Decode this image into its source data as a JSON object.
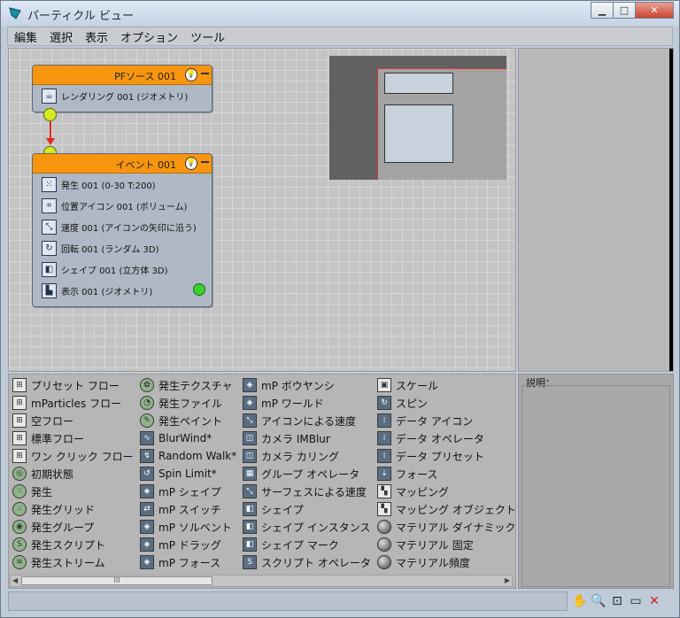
{
  "window": {
    "title": "パーティクル ビュー",
    "controls": {
      "minimize": "▁",
      "maximize": "□",
      "close": "✕"
    }
  },
  "menubar": {
    "items": [
      "編集",
      "選択",
      "表示",
      "オプション",
      "ツール"
    ]
  },
  "graph": {
    "pf_source": {
      "title": "PFソース 001",
      "operators": [
        {
          "label": "レンダリング 001 (ジオメトリ)",
          "icon": "render-teapot-icon",
          "glyph": "☕"
        }
      ]
    },
    "event": {
      "title": "イベント 001",
      "operators": [
        {
          "label": "発生 001 (0-30 T:200)",
          "icon": "birth-icon",
          "glyph": "⁙"
        },
        {
          "label": "位置アイコン 001 (ボリューム)",
          "icon": "position-icon",
          "glyph": "⌗"
        },
        {
          "label": "速度 001 (アイコンの矢印に沿う)",
          "icon": "speed-icon",
          "glyph": "⤡"
        },
        {
          "label": "回転 001 (ランダム 3D)",
          "icon": "rotation-icon",
          "glyph": "↻"
        },
        {
          "label": "シェイプ 001 (立方体 3D)",
          "icon": "shape-icon",
          "glyph": "◧"
        },
        {
          "label": "表示 001 (ジオメトリ)",
          "icon": "display-icon",
          "glyph": "▙"
        }
      ],
      "status_color": "#37d12d"
    },
    "wire_color": "#e0271c",
    "header_color": "#f7950f"
  },
  "depot": {
    "columns": [
      [
        {
          "label": "プリセット フロー",
          "icon": "flow-icon",
          "glyph": "⊞",
          "style": ""
        },
        {
          "label": "mParticles フロー",
          "icon": "flow-icon",
          "glyph": "⊞",
          "style": ""
        },
        {
          "label": "空フロー",
          "icon": "flow-icon",
          "glyph": "⊞",
          "style": ""
        },
        {
          "label": "標準フロー",
          "icon": "flow-icon",
          "glyph": "⊞",
          "style": ""
        },
        {
          "label": "ワン クリック フロー",
          "icon": "flow-icon",
          "glyph": "⊞",
          "style": ""
        },
        {
          "label": "初期状態",
          "icon": "initial-state-icon",
          "glyph": "◎",
          "style": "green"
        },
        {
          "label": "発生",
          "icon": "birth-icon",
          "glyph": "⁙",
          "style": "green"
        },
        {
          "label": "発生グリッド",
          "icon": "birth-grid-icon",
          "glyph": "⁙",
          "style": "green"
        },
        {
          "label": "発生グループ",
          "icon": "birth-group-icon",
          "glyph": "◉",
          "style": "green"
        },
        {
          "label": "発生スクリプト",
          "icon": "birth-script-icon",
          "glyph": "S",
          "style": "green"
        },
        {
          "label": "発生ストリーム",
          "icon": "birth-stream-icon",
          "glyph": "≋",
          "style": "green"
        }
      ],
      [
        {
          "label": "発生テクスチャ",
          "icon": "birth-texture-icon",
          "glyph": "✿",
          "style": "green"
        },
        {
          "label": "発生ファイル",
          "icon": "birth-file-icon",
          "glyph": "◔",
          "style": "green"
        },
        {
          "label": "発生ペイント",
          "icon": "birth-paint-icon",
          "glyph": "✎",
          "style": "green"
        },
        {
          "label": "BlurWind*",
          "icon": "blurwind-icon",
          "glyph": "∿",
          "style": "dark"
        },
        {
          "label": "Random Walk*",
          "icon": "random-walk-icon",
          "glyph": "↯",
          "style": "dark"
        },
        {
          "label": "Spin Limit*",
          "icon": "spin-limit-icon",
          "glyph": "↺",
          "style": "dark"
        },
        {
          "label": "mP シェイプ",
          "icon": "mp-shape-icon",
          "glyph": "◈",
          "style": "dark"
        },
        {
          "label": "mP スイッチ",
          "icon": "mp-switch-icon",
          "glyph": "⇄",
          "style": "dark"
        },
        {
          "label": "mP ソルベント",
          "icon": "mp-solvent-icon",
          "glyph": "◈",
          "style": "dark"
        },
        {
          "label": "mP ドラッグ",
          "icon": "mp-drag-icon",
          "glyph": "◈",
          "style": "dark"
        },
        {
          "label": "mP フォース",
          "icon": "mp-force-icon",
          "glyph": "◈",
          "style": "dark"
        }
      ],
      [
        {
          "label": "mP ボウヤンシ",
          "icon": "mp-buoyancy-icon",
          "glyph": "◈",
          "style": "dark"
        },
        {
          "label": "mP ワールド",
          "icon": "mp-world-icon",
          "glyph": "◈",
          "style": "dark"
        },
        {
          "label": "アイコンによる速度",
          "icon": "speed-by-icon-icon",
          "glyph": "⤡",
          "style": "dark"
        },
        {
          "label": "カメラ IMBlur",
          "icon": "camera-imblur-icon",
          "glyph": "◫",
          "style": "dark"
        },
        {
          "label": "カメラ カリング",
          "icon": "camera-culling-icon",
          "glyph": "◫",
          "style": "dark"
        },
        {
          "label": "グループ オペレータ",
          "icon": "group-operator-icon",
          "glyph": "▦",
          "style": "dark"
        },
        {
          "label": "サーフェスによる速度",
          "icon": "speed-by-surface-icon",
          "glyph": "⤡",
          "style": "dark"
        },
        {
          "label": "シェイプ",
          "icon": "shape-icon",
          "glyph": "◧",
          "style": "dark"
        },
        {
          "label": "シェイプ インスタンス",
          "icon": "shape-instance-icon",
          "glyph": "◧",
          "style": "dark"
        },
        {
          "label": "シェイプ マーク",
          "icon": "shape-mark-icon",
          "glyph": "◧",
          "style": "dark"
        },
        {
          "label": "スクリプト オペレータ",
          "icon": "script-operator-icon",
          "glyph": "S",
          "style": "dark"
        }
      ],
      [
        {
          "label": "スケール",
          "icon": "scale-icon",
          "glyph": "▣",
          "style": ""
        },
        {
          "label": "スピン",
          "icon": "spin-icon",
          "glyph": "↻",
          "style": "dark"
        },
        {
          "label": "データ アイコン",
          "icon": "data-icon-icon",
          "glyph": "⁞",
          "style": "dark"
        },
        {
          "label": "データ オペレータ",
          "icon": "data-operator-icon",
          "glyph": "⁞",
          "style": "dark"
        },
        {
          "label": "データ プリセット",
          "icon": "data-preset-icon",
          "glyph": "⁞",
          "style": "dark"
        },
        {
          "label": "フォース",
          "icon": "force-icon",
          "glyph": "⇣",
          "style": "dark"
        },
        {
          "label": "マッピング",
          "icon": "mapping-icon",
          "glyph": "▚",
          "style": ""
        },
        {
          "label": "マッピング オブジェクト",
          "icon": "mapping-object-icon",
          "glyph": "▚",
          "style": ""
        },
        {
          "label": "マテリアル ダイナミック",
          "icon": "material-dynamic-icon",
          "glyph": "",
          "style": "sphere"
        },
        {
          "label": "マテリアル 固定",
          "icon": "material-static-icon",
          "glyph": "",
          "style": "sphere"
        },
        {
          "label": "マテリアル頻度",
          "icon": "material-frequency-icon",
          "glyph": "",
          "style": "sphere"
        }
      ]
    ],
    "scroll_thumb": "III",
    "scroll_left": "◀",
    "scroll_right": "▶"
  },
  "description": {
    "label": "説明："
  },
  "nav_tools": [
    {
      "name": "pan-hand-icon",
      "glyph": "✋"
    },
    {
      "name": "zoom-icon",
      "glyph": "🔍"
    },
    {
      "name": "zoom-region-icon",
      "glyph": "⊡"
    },
    {
      "name": "zoom-extents-icon",
      "glyph": "▭"
    },
    {
      "name": "no-draw-icon",
      "glyph": "✕"
    }
  ]
}
